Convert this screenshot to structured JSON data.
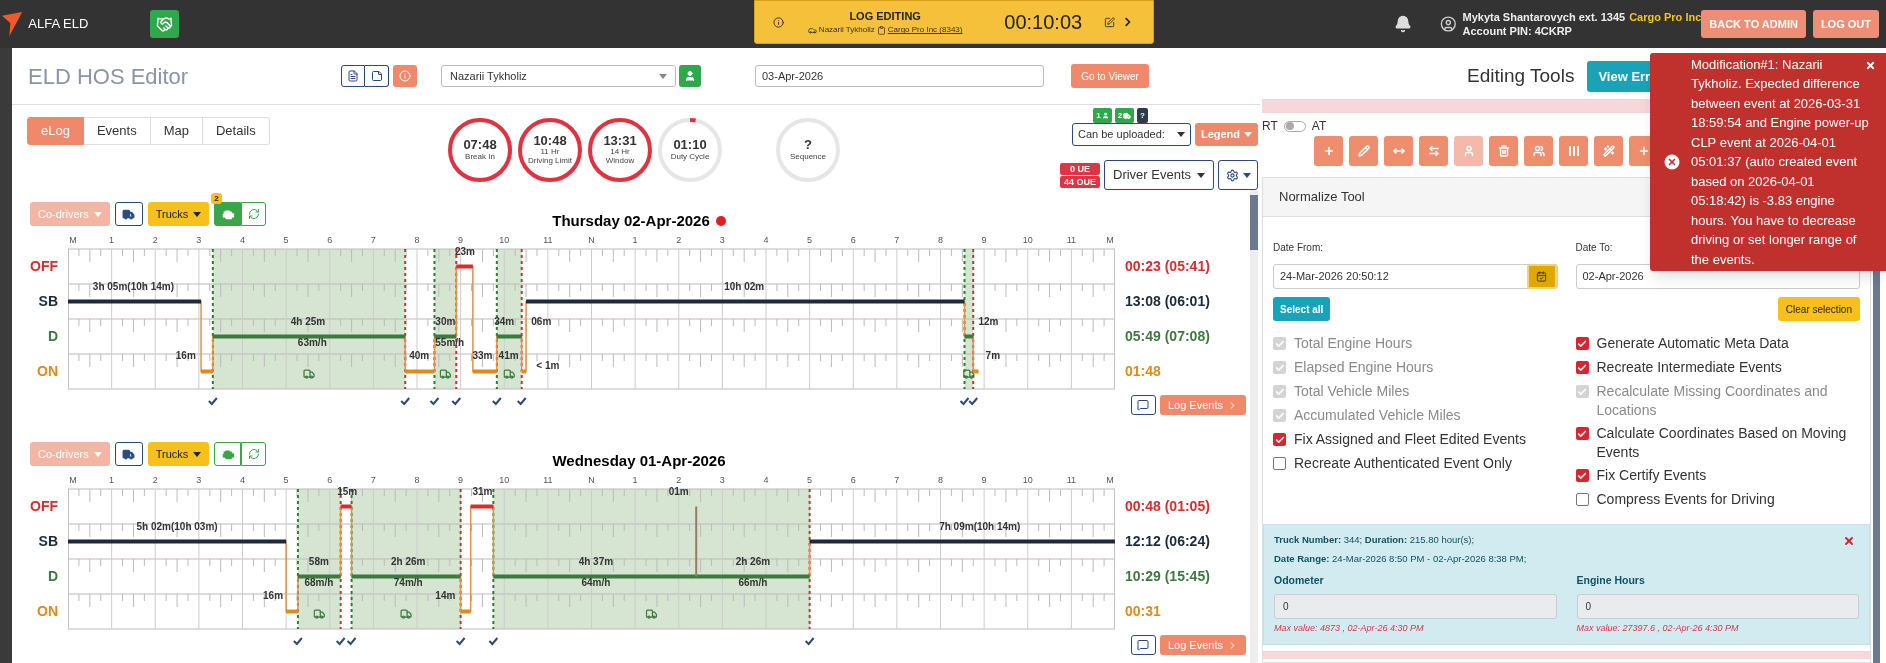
{
  "app": {
    "name": "ALFA ELD"
  },
  "banner": {
    "title": "LOG EDITING",
    "driver": "Nazarii Tykholiz",
    "company": "Cargo Pro Inc (8343)",
    "timer": "00:10:03"
  },
  "user": {
    "name": "Mykyta Shantarovych ext. 1345",
    "company": "Cargo Pro Inc",
    "pin": "Account PIN: 4CKRP"
  },
  "header_buttons": [
    "BACK TO ADMIN",
    "LOG OUT"
  ],
  "page": {
    "title": "ELD HOS Editor",
    "driver_select": "Nazarii Tykholiz",
    "date": "03-Apr-2026",
    "viewer_button": "Go to Viewer"
  },
  "tabs": [
    {
      "label": "eLog",
      "selected": true
    },
    {
      "label": "Events",
      "selected": false
    },
    {
      "label": "Map",
      "selected": false
    },
    {
      "label": "Details",
      "selected": false
    }
  ],
  "timers": [
    {
      "value": "07:48",
      "label": "Break In",
      "level": 1
    },
    {
      "value": "10:48",
      "sublabel": "11 Hr",
      "label": "Driving Limit",
      "level": 1
    },
    {
      "value": "13:31",
      "sublabel": "14 Hr",
      "label": "Window",
      "level": 1
    },
    {
      "value": "01:10",
      "label": "Duty Cycle",
      "level": 0.03
    },
    {
      "value": "?",
      "label": "Sequence"
    }
  ],
  "upload": {
    "driver_count": "1",
    "truck_count": "2",
    "help": "?",
    "select": "Can be uploaded:",
    "legend": "Legend",
    "ue": "0 UE",
    "oue": "44 OUE",
    "events_select": "Driver Events"
  },
  "graphs": [
    {
      "title": "Thursday 02-Apr-2026",
      "alert": true,
      "co_drivers": "Co-drivers",
      "co_drivers_disabled": true,
      "trucks": "Trucks",
      "engine_active": true,
      "engine_badge": "2",
      "log_events": "Log Events",
      "hours": [
        "M",
        "1",
        "2",
        "3",
        "4",
        "5",
        "6",
        "7",
        "8",
        "9",
        "10",
        "11",
        "N",
        "1",
        "2",
        "3",
        "4",
        "5",
        "6",
        "7",
        "8",
        "9",
        "10",
        "11",
        "M"
      ],
      "rows": [
        {
          "label": "OFF",
          "total": "00:23 (05:41)",
          "color": "#d32f2f"
        },
        {
          "label": "SB",
          "total": "13:08 (06:01)",
          "color": "#1c2a3a"
        },
        {
          "label": "D",
          "total": "05:49 (07:08)",
          "color": "#3d7a3d"
        },
        {
          "label": "ON",
          "total": "01:48",
          "color": "#e0891c"
        }
      ],
      "durations": [
        "3h 05m(10h 14m)",
        "16m",
        "4h 25m",
        "63m/h",
        "40m",
        "30m",
        "55m/h",
        "23m",
        "33m",
        "34m",
        "06m",
        "41m",
        "< 1m",
        "10h 02m",
        "12m",
        "7m"
      ]
    },
    {
      "title": "Wednesday 01-Apr-2026",
      "alert": false,
      "co_drivers": "Co-drivers",
      "co_drivers_disabled": true,
      "trucks": "Trucks",
      "engine_active": false,
      "log_events": "Log Events",
      "hours": [
        "M",
        "1",
        "2",
        "3",
        "4",
        "5",
        "6",
        "7",
        "8",
        "9",
        "10",
        "11",
        "N",
        "1",
        "2",
        "3",
        "4",
        "5",
        "6",
        "7",
        "8",
        "9",
        "10",
        "11",
        "M"
      ],
      "rows": [
        {
          "label": "OFF",
          "total": "00:48 (01:05)",
          "color": "#d32f2f"
        },
        {
          "label": "SB",
          "total": "12:12 (06:24)",
          "color": "#1c2a3a"
        },
        {
          "label": "D",
          "total": "10:29 (15:45)",
          "color": "#3d7a3d"
        },
        {
          "label": "ON",
          "total": "00:31",
          "color": "#e0891c"
        }
      ],
      "durations": [
        "5h 02m(10h 03m)",
        "16m",
        "58m",
        "68m/h",
        "15m",
        "2h 26m",
        "74m/h",
        "14m",
        "31m",
        "4h 37m",
        "64m/h",
        "01m",
        "2h 26m",
        "66m/h",
        "7h 09m(10h 14m)"
      ]
    }
  ],
  "editing": {
    "title": "Editing Tools",
    "view_errors": "View Err",
    "rt": "RT",
    "at": "AT",
    "at_mode": false,
    "tools": [
      {
        "kind": "add",
        "disabled": false
      },
      {
        "kind": "edit",
        "disabled": false
      },
      {
        "kind": "shift",
        "disabled": false
      },
      {
        "kind": "swap",
        "disabled": false
      },
      {
        "kind": "driver",
        "disabled": true
      },
      {
        "kind": "delete",
        "disabled": false
      },
      {
        "kind": "team",
        "disabled": false
      },
      {
        "kind": "columns",
        "disabled": false
      },
      {
        "kind": "magic",
        "disabled": false
      },
      {
        "kind": "add",
        "disabled": false
      }
    ]
  },
  "normalize": {
    "title": "Normalize Tool",
    "date_from_label": "Date From:",
    "date_from": "24-Mar-2026 20:50:12",
    "date_to_label": "Date To:",
    "date_to": "02-Apr-2026",
    "select_all": "Select all",
    "clear_selection": "Clear selection",
    "options_left": [
      {
        "label": "Total Engine Hours",
        "checked": true,
        "disabled": true
      },
      {
        "label": "Elapsed Engine Hours",
        "checked": true,
        "disabled": true
      },
      {
        "label": "Total Vehicle Miles",
        "checked": true,
        "disabled": true
      },
      {
        "label": "Accumulated Vehicle Miles",
        "checked": true,
        "disabled": true
      },
      {
        "label": "Fix Assigned and Fleet Edited Events",
        "checked": true,
        "disabled": false
      },
      {
        "label": "Recreate Authenticated Event Only",
        "checked": false,
        "disabled": false
      }
    ],
    "options_right": [
      {
        "label": "Generate Automatic Meta Data",
        "checked": true,
        "disabled": false
      },
      {
        "label": "Recreate Intermediate Events",
        "checked": true,
        "disabled": false
      },
      {
        "label": "Recalculate Missing Coordinates and Locations",
        "checked": true,
        "disabled": true
      },
      {
        "label": "Calculate Coordinates Based on Moving Events",
        "checked": true,
        "disabled": false
      },
      {
        "label": "Fix Certify Events",
        "checked": true,
        "disabled": false
      },
      {
        "label": "Compress Events for Driving",
        "checked": false,
        "disabled": false
      }
    ]
  },
  "truck_info": {
    "line1": "**Truck Number:** 344; **Duration:** 215.80 hour(s);",
    "line2": "**Date Range:** 24-Mar-2026 8:50 PM - 02-Apr-2026 8:38 PM;",
    "fields": [
      {
        "label": "Odometer",
        "value": "0",
        "hint": "Max value: 4873 , 02-Apr-26 4:30 PM"
      },
      {
        "label": "Engine Hours",
        "value": "0",
        "hint": "Max value: 27397.6 , 02-Apr-26 4:30 PM"
      }
    ]
  },
  "toast": {
    "message": "Modification#1: Nazarii Tykholiz. Expected difference between event at 2026-03-31 18:59:54 and Engine power-up CLP event at 2026-04-01 05:01:37 (auto created event based on 2026-04-01 05:18:42) is -3.83 engine hours. You have to decrease driving or set longer range of the events."
  }
}
